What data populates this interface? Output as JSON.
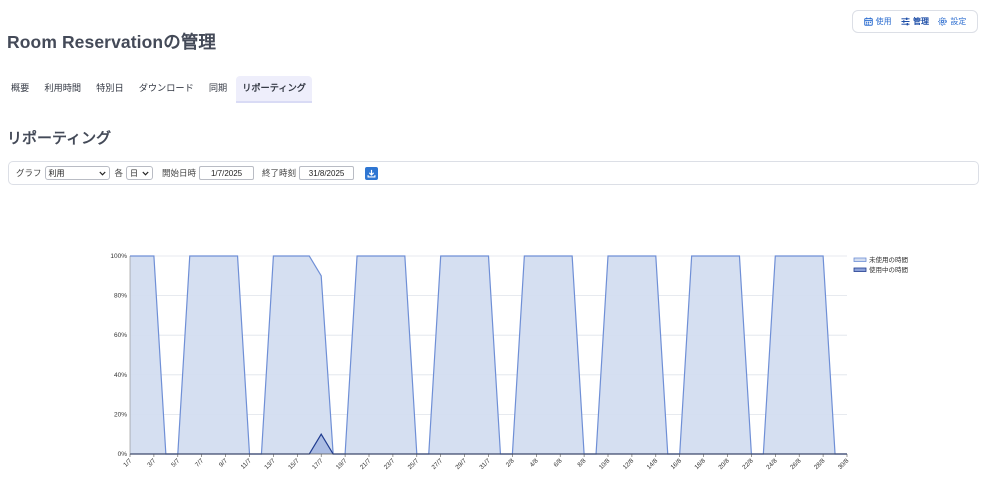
{
  "topnav": {
    "items": [
      {
        "label": "使用",
        "icon": "calendar-icon"
      },
      {
        "label": "管理",
        "icon": "sliders-icon"
      },
      {
        "label": "設定",
        "icon": "gear-icon"
      }
    ]
  },
  "page_title": "Room Reservationの管理",
  "tabs": [
    "概要",
    "利用時間",
    "特別日",
    "ダウンロード",
    "同期",
    "リポーティング"
  ],
  "active_tab": "リポーティング",
  "section_title": "リポーティング",
  "controls": {
    "graph_label": "グラフ",
    "graph_value": "利用",
    "each_label": "各",
    "each_value": "日",
    "start_label": "開始日時",
    "start_value": "1/7/2025",
    "end_label": "終了時刻",
    "end_value": "31/8/2025",
    "download_icon": "download-icon"
  },
  "colors": {
    "accent": "#2f76d2",
    "unused_fill": "#d3ddf0",
    "unused_line": "#6f8fd6",
    "used_line": "#1f3b8f"
  },
  "chart_data": {
    "type": "area",
    "x": [
      "1/7",
      "2/7",
      "3/7",
      "4/7",
      "5/7",
      "6/7",
      "7/7",
      "8/7",
      "9/7",
      "10/7",
      "11/7",
      "12/7",
      "13/7",
      "14/7",
      "15/7",
      "16/7",
      "17/7",
      "18/7",
      "19/7",
      "20/7",
      "21/7",
      "22/7",
      "23/7",
      "24/7",
      "25/7",
      "26/7",
      "27/7",
      "28/7",
      "29/7",
      "30/7",
      "31/7",
      "1/8",
      "2/8",
      "3/8",
      "4/8",
      "5/8",
      "6/8",
      "7/8",
      "8/8",
      "9/8",
      "10/8",
      "11/8",
      "12/8",
      "13/8",
      "14/8",
      "15/8",
      "16/8",
      "17/8",
      "18/8",
      "19/8",
      "20/8",
      "21/8",
      "22/8",
      "23/8",
      "24/8",
      "25/8",
      "26/8",
      "27/8",
      "28/8",
      "29/8",
      "30/8"
    ],
    "tick_labels": [
      "1/7",
      "3/7",
      "5/7",
      "7/7",
      "9/7",
      "11/7",
      "13/7",
      "15/7",
      "17/7",
      "19/7",
      "21/7",
      "23/7",
      "25/7",
      "27/7",
      "29/7",
      "31/7",
      "2/8",
      "4/8",
      "6/8",
      "8/8",
      "10/8",
      "12/8",
      "14/8",
      "16/8",
      "18/8",
      "20/8",
      "22/8",
      "24/8",
      "26/8",
      "28/8",
      "30/8"
    ],
    "series": [
      {
        "name": "未使用の時間",
        "values": [
          100,
          100,
          100,
          0,
          0,
          100,
          100,
          100,
          100,
          100,
          0,
          0,
          100,
          100,
          100,
          100,
          90,
          0,
          0,
          100,
          100,
          100,
          100,
          100,
          0,
          0,
          100,
          100,
          100,
          100,
          100,
          0,
          0,
          100,
          100,
          100,
          100,
          100,
          0,
          0,
          100,
          100,
          100,
          100,
          100,
          0,
          0,
          100,
          100,
          100,
          100,
          100,
          0,
          0,
          100,
          100,
          100,
          100,
          100,
          0,
          0
        ]
      },
      {
        "name": "使用中の時間",
        "values": [
          0,
          0,
          0,
          0,
          0,
          0,
          0,
          0,
          0,
          0,
          0,
          0,
          0,
          0,
          0,
          0,
          10,
          0,
          0,
          0,
          0,
          0,
          0,
          0,
          0,
          0,
          0,
          0,
          0,
          0,
          0,
          0,
          0,
          0,
          0,
          0,
          0,
          0,
          0,
          0,
          0,
          0,
          0,
          0,
          0,
          0,
          0,
          0,
          0,
          0,
          0,
          0,
          0,
          0,
          0,
          0,
          0,
          0,
          0,
          0,
          0
        ]
      }
    ],
    "y_ticks": [
      "0%",
      "20%",
      "40%",
      "60%",
      "80%",
      "100%"
    ],
    "ylim": [
      0,
      100
    ],
    "grid": true,
    "legend_position": "top-right"
  }
}
